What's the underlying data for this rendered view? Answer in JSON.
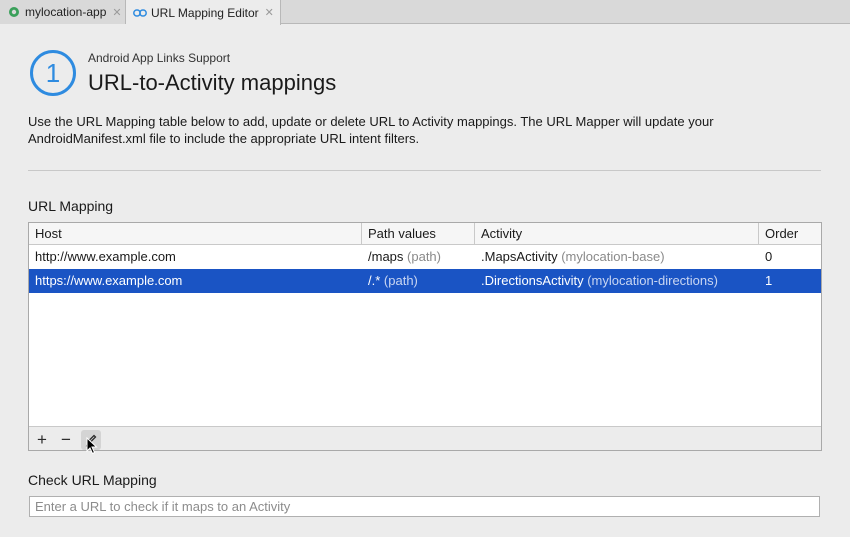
{
  "tabs": [
    {
      "label": "mylocation-app",
      "close": "✕"
    },
    {
      "label": "URL Mapping Editor",
      "close": "✕"
    }
  ],
  "header": {
    "step_number": "1",
    "subtitle": "Android App Links Support",
    "title": "URL-to-Activity mappings",
    "description": "Use the URL Mapping table below to add, update or delete URL to Activity mappings. The URL Mapper will update your AndroidManifest.xml file to include the appropriate URL intent filters."
  },
  "url_mapping": {
    "label": "URL Mapping",
    "columns": [
      "Host",
      "Path values",
      "Activity",
      "Order"
    ],
    "rows": [
      {
        "host": "http://www.example.com",
        "path": "/maps",
        "path_type": "(path)",
        "activity": ".MapsActivity",
        "module": "(mylocation-base)",
        "order": "0",
        "selected": false
      },
      {
        "host": "https://www.example.com",
        "path": "/.*",
        "path_type": "(path)",
        "activity": ".DirectionsActivity",
        "module": "(mylocation-directions)",
        "order": "1",
        "selected": true
      }
    ],
    "toolbar": {
      "add": "+",
      "remove": "−",
      "edit": "✎"
    }
  },
  "check": {
    "label": "Check URL Mapping",
    "placeholder": "Enter a URL to check if it maps to an Activity",
    "value": ""
  },
  "colors": {
    "accent": "#2e8be0",
    "selection": "#1a54c4",
    "app_icon": "#3aa05a"
  },
  "icons": {
    "app_tab": "android-module-icon",
    "editor_tab": "link-icon",
    "cursor": "mouse-pointer-icon"
  }
}
